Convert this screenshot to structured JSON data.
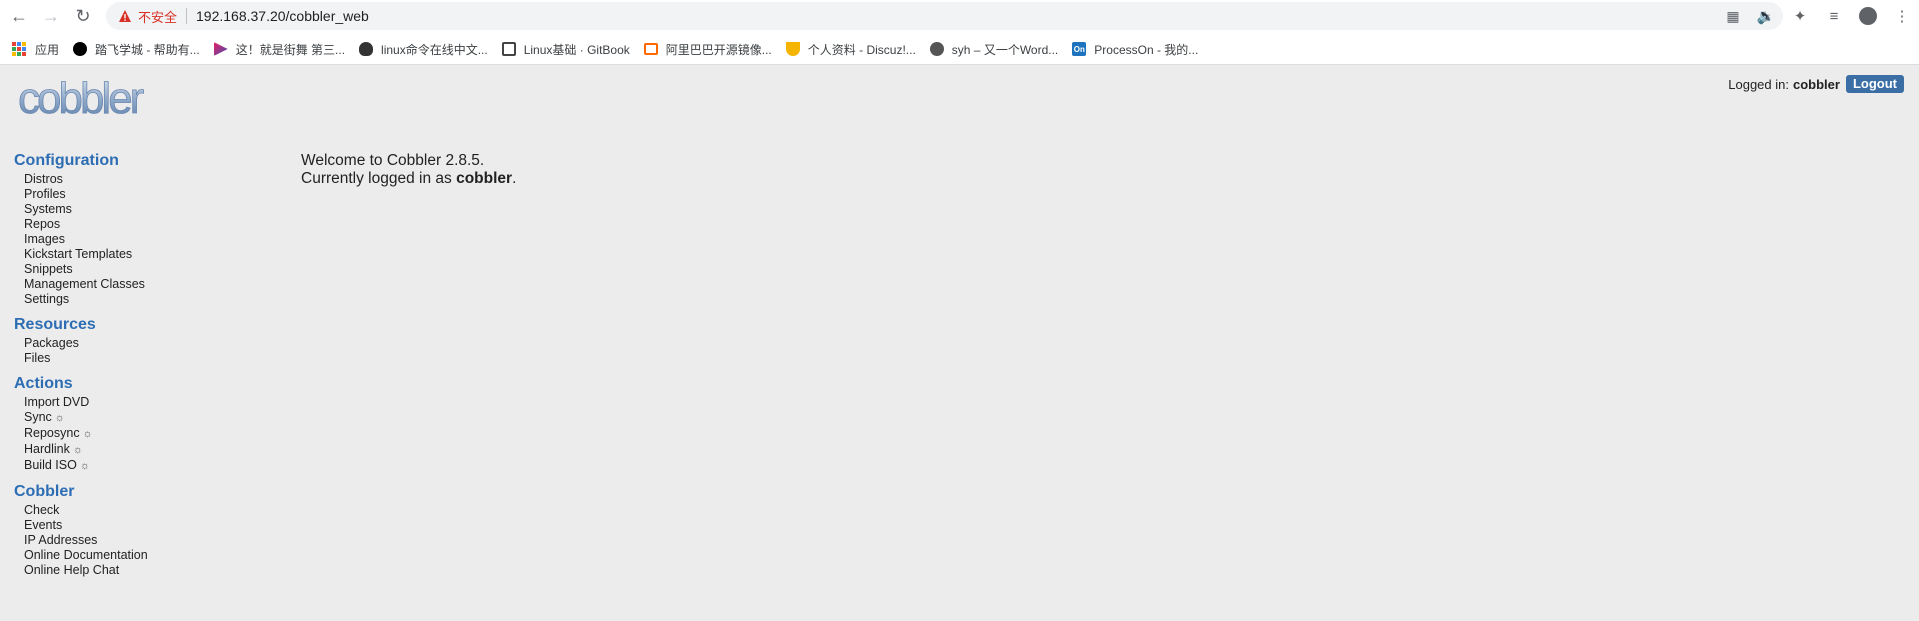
{
  "browser": {
    "insecure_label": "不安全",
    "url": "192.168.37.20/cobbler_web",
    "bookmarks": [
      {
        "label": "应用",
        "icon": "apps-grid-icon"
      },
      {
        "label": "踏飞学城 - 帮助有...",
        "icon": "circle-logo-icon",
        "color": "#000000"
      },
      {
        "label": "这！就是街舞 第三...",
        "icon": "play-logo-icon",
        "color": "#e91e63"
      },
      {
        "label": "linux命令在线中文...",
        "icon": "penguin-icon",
        "color": "#333333"
      },
      {
        "label": "Linux基础 · GitBook",
        "icon": "book-icon",
        "color": "#444444"
      },
      {
        "label": "阿里巴巴开源镜像...",
        "icon": "alibaba-logo-icon",
        "color": "#ff6a00"
      },
      {
        "label": "个人资料 - Discuz!...",
        "icon": "trophy-icon",
        "color": "#f4b400"
      },
      {
        "label": "syh – 又一个Word...",
        "icon": "wordpress-icon",
        "color": "#555555"
      },
      {
        "label": "ProcessOn - 我的...",
        "icon": "processon-logo-icon",
        "color": "#1e73be"
      }
    ]
  },
  "header": {
    "logo_text": "cobbler",
    "logged_in_label": "Logged in:",
    "username": "cobbler",
    "logout_label": "Logout"
  },
  "sidebar": {
    "configuration": {
      "title": "Configuration",
      "items": [
        "Distros",
        "Profiles",
        "Systems",
        "Repos",
        "Images",
        "Kickstart Templates",
        "Snippets",
        "Management Classes",
        "Settings"
      ]
    },
    "resources": {
      "title": "Resources",
      "items": [
        "Packages",
        "Files"
      ]
    },
    "actions": {
      "title": "Actions",
      "items": [
        "Import DVD",
        "Sync",
        "Reposync",
        "Hardlink",
        "Build ISO"
      ],
      "spinner_glyph": "☼"
    },
    "cobbler": {
      "title": "Cobbler",
      "items": [
        "Check",
        "Events",
        "IP Addresses",
        "Online Documentation",
        "Online Help Chat"
      ]
    }
  },
  "main": {
    "welcome": "Welcome to Cobbler 2.8.5.",
    "logged_in_prefix": "Currently logged in as",
    "logged_in_user": "cobbler",
    "logged_in_suffix": "."
  },
  "colors": {
    "accent": "#2d6db3",
    "logout_bg": "#3a6ea5",
    "page_bg": "#ececec",
    "insecure": "#d93025"
  }
}
